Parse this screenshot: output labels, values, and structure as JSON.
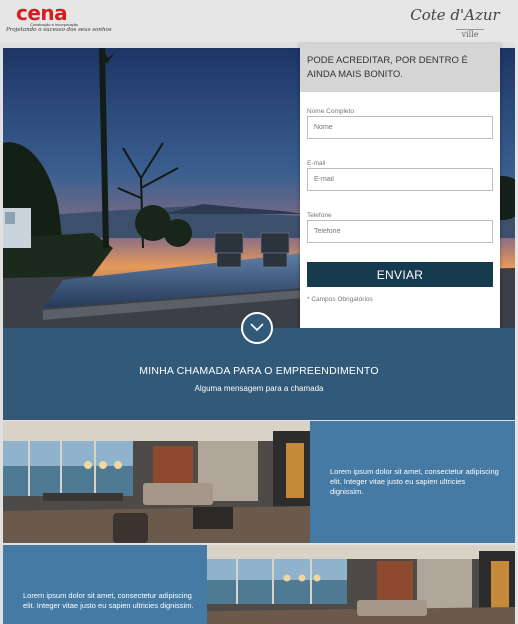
{
  "header": {
    "brand_left": "cena",
    "brand_left_sub": "Construção e Incorporação",
    "brand_left_tagline": "Projetando o sucesso dos seus sonhos",
    "brand_right": "Cote d'Azur",
    "brand_right_sub": "ville"
  },
  "form": {
    "heading": "PODE ACREDITAR, POR DENTRO É AINDA MAIS BONITO.",
    "fields": [
      {
        "label": "Nome Completo",
        "placeholder": "Nome"
      },
      {
        "label": "E-mail",
        "placeholder": "E-mail"
      },
      {
        "label": "Telefone",
        "placeholder": "Telefone"
      }
    ],
    "submit_label": "ENVIAR",
    "required_note": "* Campos Obrigatórios"
  },
  "call": {
    "title": "MINHA CHAMADA PARA O EMPREENDIMENTO",
    "subtitle": "Alguma mensagem para a chamada"
  },
  "features": [
    {
      "text": "Lorem ipsum dolor sit amet, consectetur adipiscing elit. Integer vitae justo eu sapien ultricies dignissim."
    },
    {
      "text": "Lorem ipsum dolor sit amet, consectetur adipiscing elit. Integer vitae justo eu sapien ultricies dignissim."
    }
  ],
  "colors": {
    "accent_dark": "#163b4e",
    "section_blue": "#325a78",
    "feature_blue": "#447aa3",
    "brand_red": "#d21f1f"
  },
  "icons": {
    "scroll_down": "chevron-down-icon"
  }
}
